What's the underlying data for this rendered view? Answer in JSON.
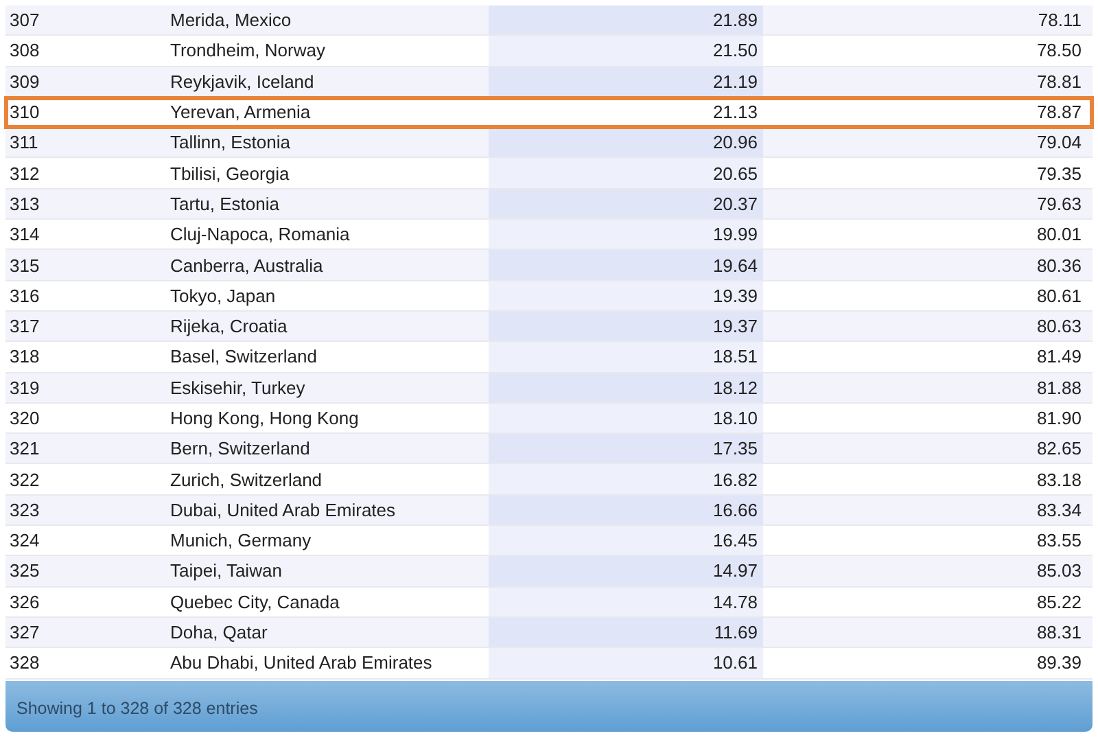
{
  "table": {
    "rows": [
      {
        "rank": "307",
        "city": "Merida, Mexico",
        "column_3": "21.89",
        "column_4": "78.11",
        "highlighted": false
      },
      {
        "rank": "308",
        "city": "Trondheim, Norway",
        "column_3": "21.50",
        "column_4": "78.50",
        "highlighted": false
      },
      {
        "rank": "309",
        "city": "Reykjavik, Iceland",
        "column_3": "21.19",
        "column_4": "78.81",
        "highlighted": false
      },
      {
        "rank": "310",
        "city": "Yerevan, Armenia",
        "column_3": "21.13",
        "column_4": "78.87",
        "highlighted": true
      },
      {
        "rank": "311",
        "city": "Tallinn, Estonia",
        "column_3": "20.96",
        "column_4": "79.04",
        "highlighted": false
      },
      {
        "rank": "312",
        "city": "Tbilisi, Georgia",
        "column_3": "20.65",
        "column_4": "79.35",
        "highlighted": false
      },
      {
        "rank": "313",
        "city": "Tartu, Estonia",
        "column_3": "20.37",
        "column_4": "79.63",
        "highlighted": false
      },
      {
        "rank": "314",
        "city": "Cluj-Napoca, Romania",
        "column_3": "19.99",
        "column_4": "80.01",
        "highlighted": false
      },
      {
        "rank": "315",
        "city": "Canberra, Australia",
        "column_3": "19.64",
        "column_4": "80.36",
        "highlighted": false
      },
      {
        "rank": "316",
        "city": "Tokyo, Japan",
        "column_3": "19.39",
        "column_4": "80.61",
        "highlighted": false
      },
      {
        "rank": "317",
        "city": "Rijeka, Croatia",
        "column_3": "19.37",
        "column_4": "80.63",
        "highlighted": false
      },
      {
        "rank": "318",
        "city": "Basel, Switzerland",
        "column_3": "18.51",
        "column_4": "81.49",
        "highlighted": false
      },
      {
        "rank": "319",
        "city": "Eskisehir, Turkey",
        "column_3": "18.12",
        "column_4": "81.88",
        "highlighted": false
      },
      {
        "rank": "320",
        "city": "Hong Kong, Hong Kong",
        "column_3": "18.10",
        "column_4": "81.90",
        "highlighted": false
      },
      {
        "rank": "321",
        "city": "Bern, Switzerland",
        "column_3": "17.35",
        "column_4": "82.65",
        "highlighted": false
      },
      {
        "rank": "322",
        "city": "Zurich, Switzerland",
        "column_3": "16.82",
        "column_4": "83.18",
        "highlighted": false
      },
      {
        "rank": "323",
        "city": "Dubai, United Arab Emirates",
        "column_3": "16.66",
        "column_4": "83.34",
        "highlighted": false
      },
      {
        "rank": "324",
        "city": "Munich, Germany",
        "column_3": "16.45",
        "column_4": "83.55",
        "highlighted": false
      },
      {
        "rank": "325",
        "city": "Taipei, Taiwan",
        "column_3": "14.97",
        "column_4": "85.03",
        "highlighted": false
      },
      {
        "rank": "326",
        "city": "Quebec City, Canada",
        "column_3": "14.78",
        "column_4": "85.22",
        "highlighted": false
      },
      {
        "rank": "327",
        "city": "Doha, Qatar",
        "column_3": "11.69",
        "column_4": "88.31",
        "highlighted": false
      },
      {
        "rank": "328",
        "city": "Abu Dhabi, United Arab Emirates",
        "column_3": "10.61",
        "column_4": "89.39",
        "highlighted": false
      }
    ]
  },
  "footer": {
    "info": "Showing 1 to 328 of 328 entries"
  }
}
